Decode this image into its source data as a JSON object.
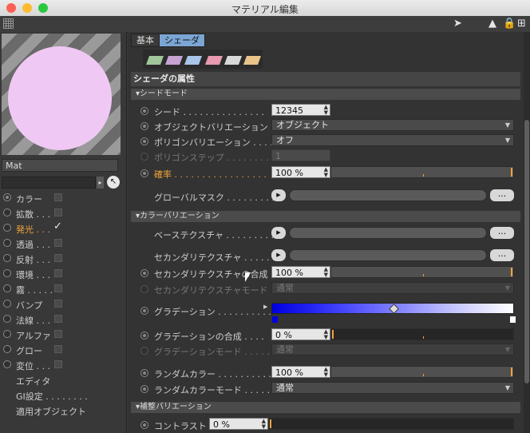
{
  "window": {
    "title": "マテリアル編集"
  },
  "left": {
    "material_name": "Mat",
    "channels": [
      {
        "label": "カラー",
        "checked": false,
        "highlight": false
      },
      {
        "label": "拡散 . . .",
        "checked": false,
        "highlight": false
      },
      {
        "label": "発光 . . .",
        "checked": true,
        "highlight": true
      },
      {
        "label": "透過 . . .",
        "checked": false,
        "highlight": false
      },
      {
        "label": "反射 . . .",
        "checked": false,
        "highlight": false
      },
      {
        "label": "環境 . . .",
        "checked": false,
        "highlight": false
      },
      {
        "label": "霧 . . . . .",
        "checked": false,
        "highlight": false
      },
      {
        "label": "バンプ",
        "checked": false,
        "highlight": false
      },
      {
        "label": "法線 . . .",
        "checked": false,
        "highlight": false
      },
      {
        "label": "アルファ",
        "checked": false,
        "highlight": false
      },
      {
        "label": "グロー",
        "checked": false,
        "highlight": false
      },
      {
        "label": "変位 . . .",
        "checked": false,
        "highlight": false
      }
    ],
    "menu": [
      "エディタ",
      "GI設定 . . . . . . . .",
      "適用オブジェクト"
    ]
  },
  "tabs": [
    "基本",
    "シェーダ"
  ],
  "section_title": "シェーダの属性",
  "subsections": {
    "seed_mode": "▾シードモード",
    "color_variation": "▾カラーバリエーション",
    "comp_variation": "▾補整バリエーション"
  },
  "rows": {
    "seed": {
      "label": "シード . . . . . . . . . . . . . . .",
      "value": "12345"
    },
    "object_variation": {
      "label": "オブジェクトバリエーション",
      "value": "オブジェクト"
    },
    "polygon_variation": {
      "label": "ポリゴンバリエーション . . . .",
      "value": "オフ"
    },
    "polygon_step": {
      "label": "ポリゴンステップ . . . . . . . . .",
      "value": "1"
    },
    "probability": {
      "label": "確率 . . . . . . . . . . . . . . . . .",
      "value": "100 %"
    },
    "global_mask": {
      "label": "グローバルマスク . . . . . . . . ."
    },
    "base_texture": {
      "label": "ベーステクスチャ . . . . . . . . ."
    },
    "secondary_texture": {
      "label": "セカンダリテクスチャ . . . . . ."
    },
    "secondary_blend": {
      "label": "セカンダリテクスチャの合成",
      "value": "100 %"
    },
    "secondary_mode": {
      "label": "セカンダリテクスチャモード",
      "value": "通常"
    },
    "gradient": {
      "label": "グラデーション . . . . . . . . . ."
    },
    "gradient_blend": {
      "label": "グラデーションの合成 . . . .",
      "value": "0 %"
    },
    "gradient_mode": {
      "label": "グラデーションモード . . . . .",
      "value": "通常"
    },
    "random_color": {
      "label": "ランダムカラー . . . . . . . . . .",
      "value": "100 %"
    },
    "random_color_mode": {
      "label": "ランダムカラーモード . . . . .",
      "value": "通常"
    },
    "contrast": {
      "label": "コントラスト",
      "value": "0 %"
    }
  },
  "dots_label": "...",
  "colors": {
    "accent": "#f1a23a",
    "tab_active": "#7ba6d4",
    "sphere": "#efc9f3"
  },
  "icons": [
    "grid-icon",
    "back-arrow-icon",
    "pointer-icon",
    "lock-icon",
    "new-window-icon",
    "eyedropper-icon"
  ]
}
